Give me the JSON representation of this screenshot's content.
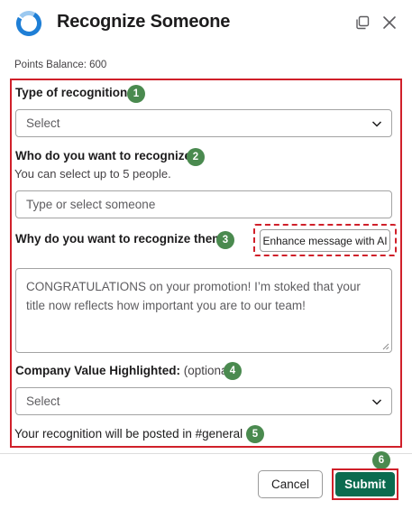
{
  "header": {
    "title": "Recognize Someone",
    "logo_icon": "circular-logo-icon",
    "popout_icon": "popout-window-icon",
    "close_icon": "close-icon"
  },
  "points_balance": "Points Balance: 600",
  "form": {
    "type_of_recognition": {
      "label": "Type of recognition:",
      "select_value": "Select",
      "step": "1"
    },
    "who": {
      "label": "Who do you want to recognize:",
      "hint": "You can select up to 5 people.",
      "placeholder": "Type or select someone",
      "step": "2"
    },
    "why": {
      "label": "Why do you want to recognize them:",
      "enhance_button": "Enhance message with AI",
      "message": "CONGRATULATIONS on your promotion! I’m stoked that your title now reflects how important you are to our team!",
      "step": "3"
    },
    "company_value": {
      "label": "Company Value Highlighted:",
      "optional": "(optional)",
      "select_value": "Select",
      "step": "4"
    },
    "posted_in": {
      "text": "Your recognition will be posted in #general",
      "step": "5"
    }
  },
  "footer": {
    "cancel_label": "Cancel",
    "submit_label": "Submit",
    "submit_step": "6"
  },
  "colors": {
    "accent": "#0b6b4f",
    "highlight": "#d0202a",
    "badge": "#4a8a4f",
    "logo_blue": "#1f7fd6"
  }
}
